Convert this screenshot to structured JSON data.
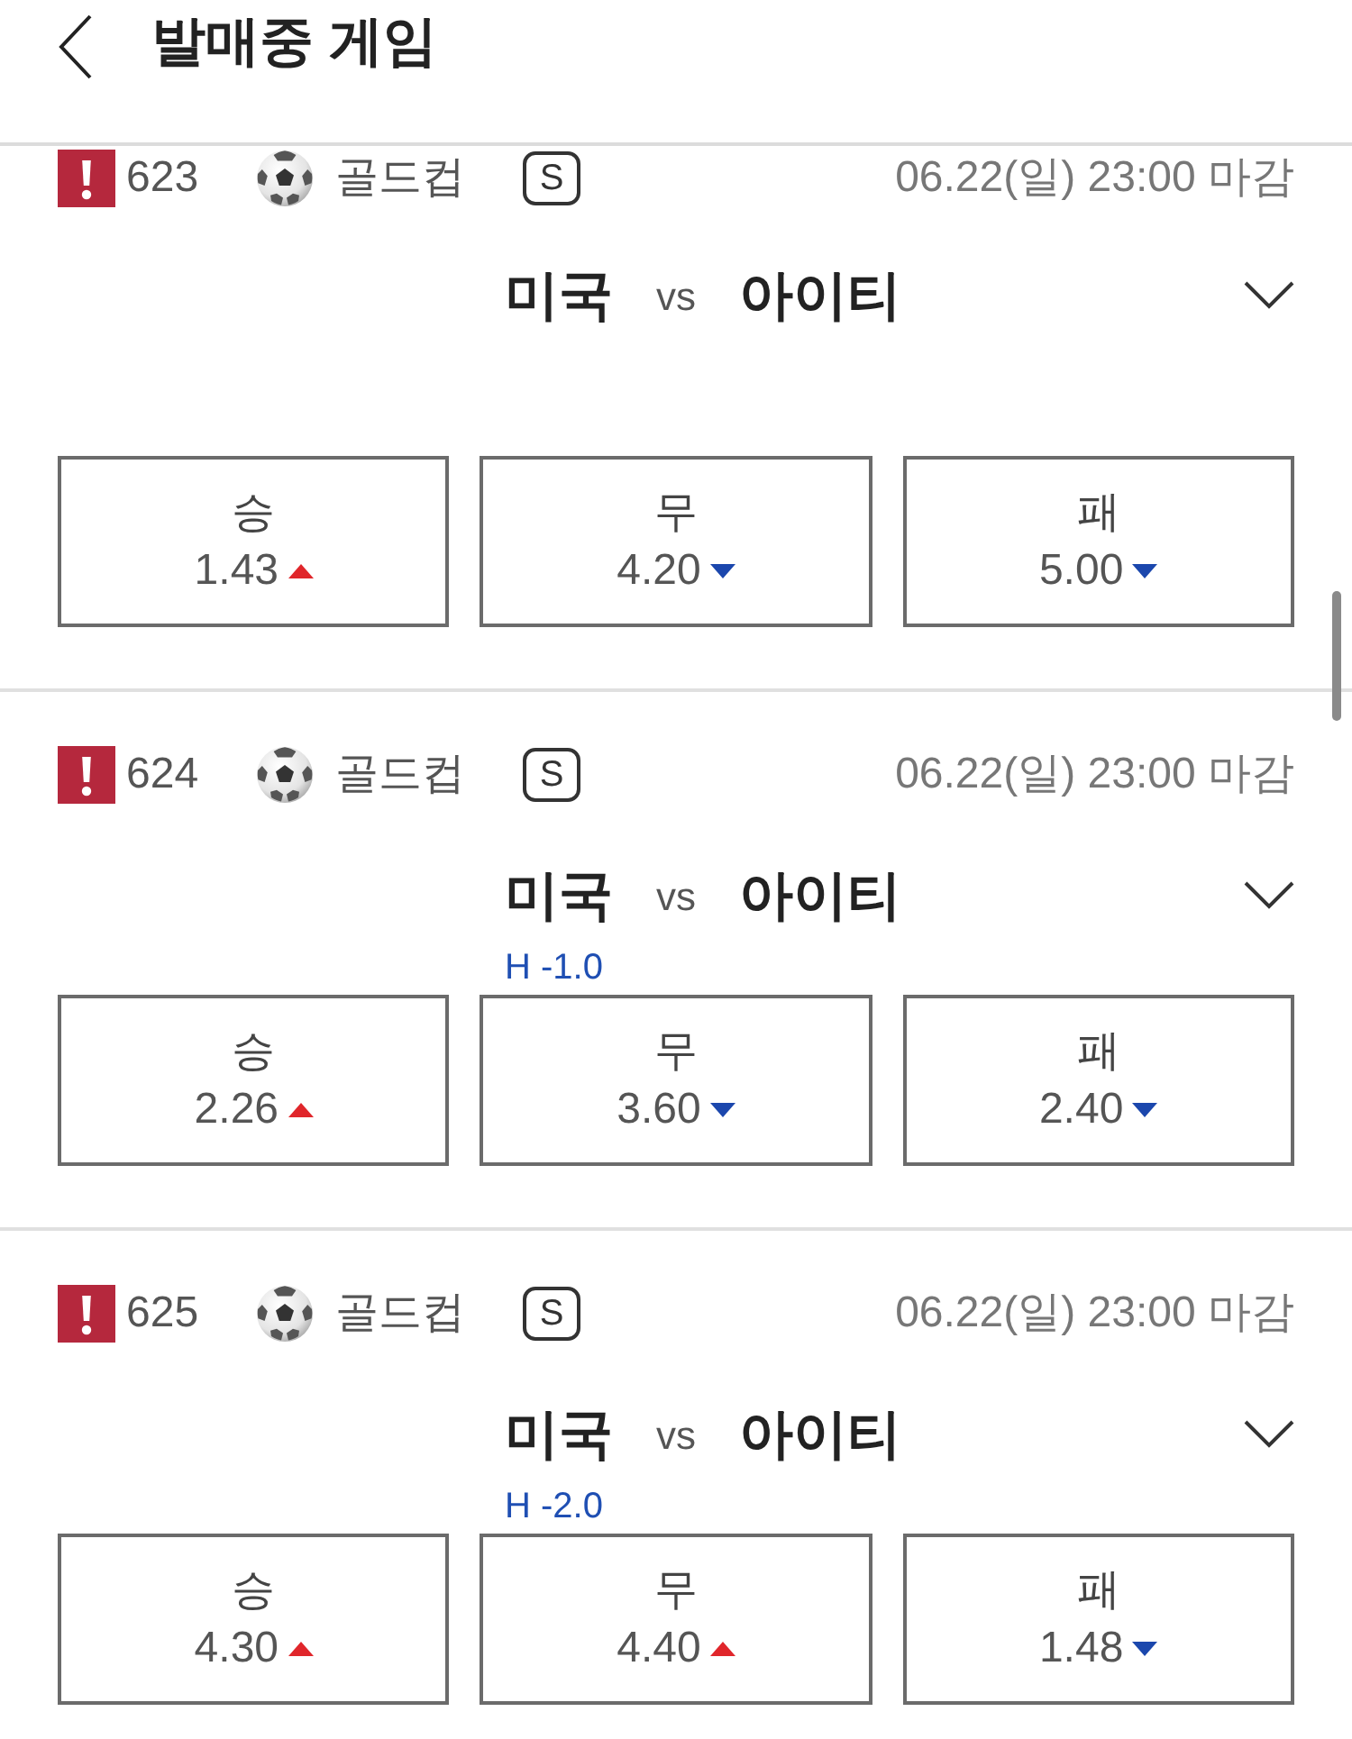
{
  "header": {
    "title": "발매중 게임"
  },
  "games": [
    {
      "number": "623",
      "league": "골드컵",
      "badge": "S",
      "deadline": "06.22(일) 23:00 마감",
      "home": "미국",
      "vs": "vs",
      "away": "아이티",
      "odds": [
        {
          "label": "승",
          "value": "1.43",
          "rising": true
        },
        {
          "label": "무",
          "value": "4.20",
          "rising": false
        },
        {
          "label": "패",
          "value": "5.00",
          "rising": false
        }
      ]
    },
    {
      "number": "624",
      "league": "골드컵",
      "badge": "S",
      "deadline": "06.22(일) 23:00 마감",
      "home": "미국",
      "vs": "vs",
      "away": "아이티",
      "handicap": "H -1.0",
      "odds": [
        {
          "label": "승",
          "value": "2.26",
          "rising": true
        },
        {
          "label": "무",
          "value": "3.60",
          "rising": false
        },
        {
          "label": "패",
          "value": "2.40",
          "rising": false
        }
      ]
    },
    {
      "number": "625",
      "league": "골드컵",
      "badge": "S",
      "deadline": "06.22(일) 23:00 마감",
      "home": "미국",
      "vs": "vs",
      "away": "아이티",
      "handicap": "H -2.0",
      "odds": [
        {
          "label": "승",
          "value": "4.30",
          "rising": true
        },
        {
          "label": "무",
          "value": "4.40",
          "rising": true
        },
        {
          "label": "패",
          "value": "1.48",
          "rising": false
        }
      ]
    }
  ]
}
